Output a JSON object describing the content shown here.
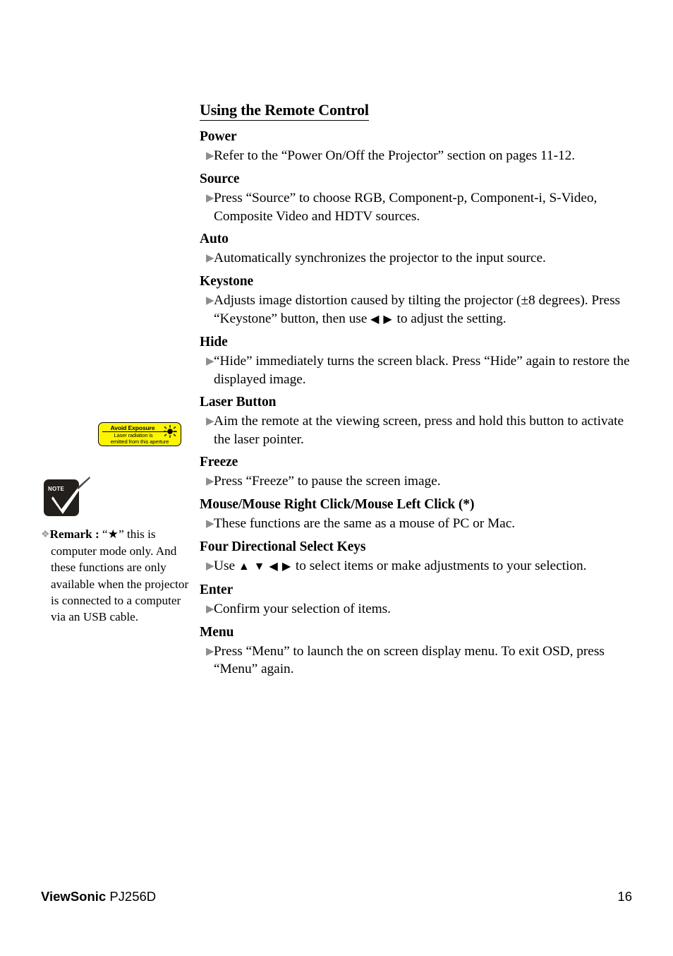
{
  "page": {
    "title": "Using the Remote Control"
  },
  "sections": [
    {
      "heading": "Power",
      "bullets": [
        "Refer to the “Power On/Off the Projector” section on pages 11-12."
      ]
    },
    {
      "heading": "Source",
      "bullets": [
        "Press “Source” to choose RGB, Component-p, Component-i, S-Video, Composite Video and HDTV sources."
      ]
    },
    {
      "heading": "Auto",
      "bullets": [
        "Automatically synchronizes the projector to the input source."
      ]
    },
    {
      "heading": "Keystone",
      "bullets_rich": [
        {
          "pre": "Adjusts image distortion caused by tilting the projector (±8 degrees). Press “Keystone” button, then use ",
          "arrows": [
            "◀",
            "▶"
          ],
          "post": " to adjust the setting."
        }
      ]
    },
    {
      "heading": "Hide",
      "bullets": [
        "“Hide” immediately turns the screen black. Press “Hide” again to restore the displayed image."
      ]
    },
    {
      "heading": "Laser Button",
      "bullets": [
        "Aim the remote at the viewing screen, press and hold this button to activate the laser pointer."
      ]
    },
    {
      "heading": "Freeze",
      "bullets": [
        "Press “Freeze” to pause the screen image."
      ]
    },
    {
      "heading": "Mouse/Mouse Right Click/Mouse Left Click  (*)",
      "bullets": [
        "These functions are the same as a mouse of PC or Mac."
      ]
    },
    {
      "heading": "Four Directional Select Keys",
      "bullets_rich": [
        {
          "pre": "Use  ",
          "arrows": [
            "▲",
            "▼",
            "◀",
            "▶"
          ],
          "post": " to select items or make adjustments to your selection."
        }
      ]
    },
    {
      "heading": "Enter",
      "bullets": [
        "Confirm your selection of items."
      ]
    },
    {
      "heading": "Menu",
      "bullets": [
        "Press “Menu” to launch the on screen display menu.  To exit OSD, press “Menu” again."
      ]
    }
  ],
  "margin_notes": {
    "laser_label": {
      "line1": "Avoid Exposure",
      "line2": "Laser radiation is",
      "line3": "emitted from this aperture",
      "background_color": "#fdf500",
      "text_color": "#000000"
    },
    "note_icon_label": "Note",
    "remark": {
      "label": "Remark :",
      "symbol": "“★”",
      "text": " this is computer mode only. And these functions are only available when the projector is connected to a computer via an USB cable."
    }
  },
  "footer": {
    "brand": "ViewSonic",
    "model": "PJ256D",
    "page_number": "16"
  }
}
